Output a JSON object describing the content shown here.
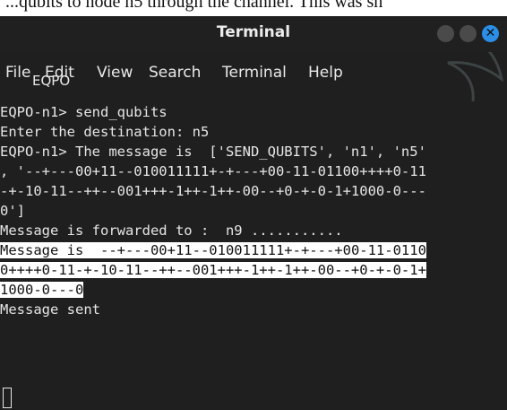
{
  "caption_strip": "...qubits to node n5 through the channel. This was sh",
  "window": {
    "title": "Terminal"
  },
  "menu": {
    "items": [
      "File",
      "Edit",
      "View",
      "Search",
      "Terminal",
      "Help"
    ],
    "overlay_text": "EQPO"
  },
  "terminal": {
    "lines": [
      {
        "text": "EQPO-n1> send_qubits",
        "hl": ""
      },
      {
        "text": "Enter the destination: n5",
        "hl": ""
      },
      {
        "text": "EQPO-n1> The message is  ['SEND_QUBITS', 'n1', 'n5'",
        "hl": ""
      },
      {
        "text": ", '--+---00+11--010011111+-+---+00-11-01100++++0-11",
        "hl": ""
      },
      {
        "text": "-+-10-11--++--001+++-1++-1++-00--+0-+-0-1+1000-0---",
        "hl": ""
      },
      {
        "text": "0']",
        "hl": ""
      },
      {
        "text": "Message is forwarded to :  n9 ...........",
        "hl": ""
      },
      {
        "text": "Message is  ",
        "hl": "--+---00+11--010011111+-+---+00-11-0110"
      },
      {
        "text": "",
        "hl": "0++++0-11-+-10-11--++--001+++-1++-1++-00--+0-+-0-1+"
      },
      {
        "text": "",
        "hl": "1000-0---0"
      },
      {
        "text": "Message sent",
        "hl": ""
      }
    ]
  },
  "colors": {
    "background": "#1f1f1f",
    "text": "#e6e6e6",
    "close_button": "#2c8fe6",
    "highlight": "#ffffff"
  }
}
